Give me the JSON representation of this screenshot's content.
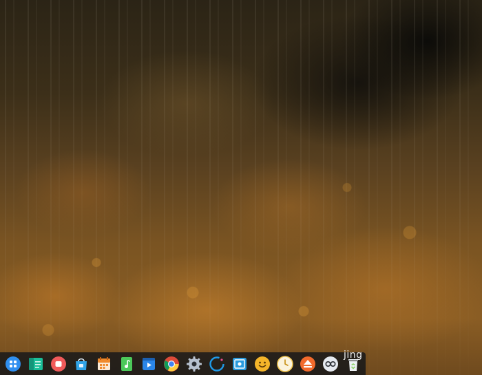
{
  "desktop": {
    "wallpaper": "autumn-forest-wallpaper"
  },
  "dock": {
    "label": "jing",
    "items": [
      {
        "name": "launcher-icon",
        "color": "#2f8ff0"
      },
      {
        "name": "file-manager-icon",
        "color": "#1bbf9a"
      },
      {
        "name": "screen-recorder-icon",
        "color": "#f05a5a"
      },
      {
        "name": "app-store-icon",
        "color": "#30a4e8"
      },
      {
        "name": "calendar-icon",
        "color": "#f08a2c"
      },
      {
        "name": "music-player-icon",
        "color": "#4cc95a"
      },
      {
        "name": "video-player-icon",
        "color": "#2a86e8"
      },
      {
        "name": "chrome-browser-icon",
        "color": "#dd4b39"
      },
      {
        "name": "settings-icon",
        "color": "#9aa7b8"
      },
      {
        "name": "deepin-ring-icon",
        "color": "#1f9ae8"
      },
      {
        "name": "screenshot-icon",
        "color": "#2a9bdd"
      },
      {
        "name": "emoji-app-icon",
        "color": "#f4b52a"
      },
      {
        "name": "clock-icon",
        "color": "#f2c652"
      },
      {
        "name": "installer-icon",
        "color": "#f26a2c"
      },
      {
        "name": "system-monitor-icon",
        "color": "#d8dde6"
      },
      {
        "name": "trash-icon",
        "color": "#8fd36b"
      }
    ]
  }
}
